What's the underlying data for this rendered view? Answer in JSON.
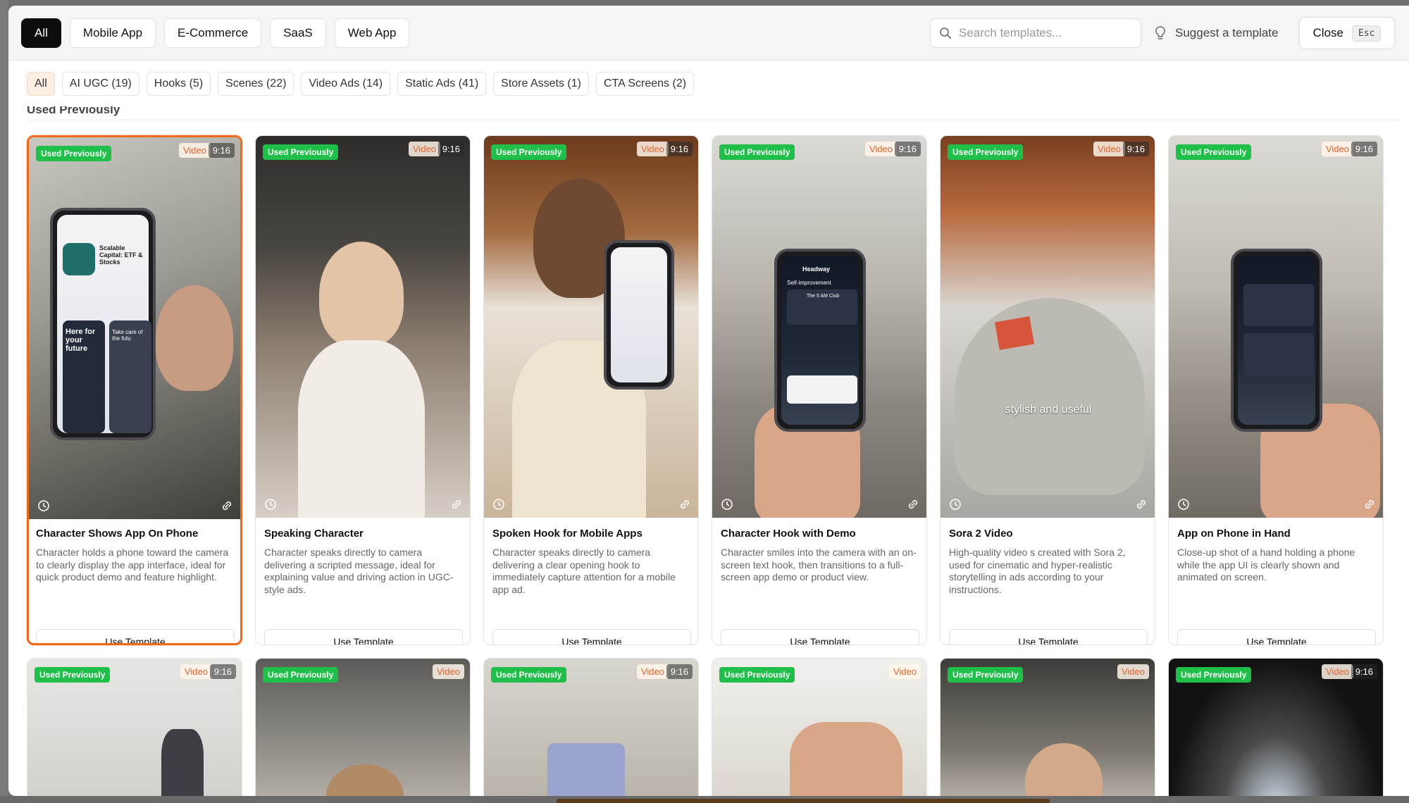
{
  "categories": [
    "All",
    "Mobile App",
    "E-Commerce",
    "SaaS",
    "Web App"
  ],
  "search": {
    "placeholder": "Search templates..."
  },
  "suggest_label": "Suggest a template",
  "close": {
    "label": "Close",
    "shortcut": "Esc"
  },
  "filters": [
    "All",
    "AI UGC (19)",
    "Hooks (5)",
    "Scenes (22)",
    "Video Ads (14)",
    "Static Ads (41)",
    "Store Assets (1)",
    "CTA Screens (2)"
  ],
  "section_title": "Used Previously",
  "badge_used": "Used Previously",
  "use_button_label": "Use Template",
  "templates": [
    {
      "type": "Video",
      "ratio": "9:16",
      "title": "Character Shows App On Phone",
      "description": "Character holds a phone toward the camera to clearly display the app interface, ideal for quick product demo and feature highlight."
    },
    {
      "type": "Video",
      "ratio": "9:16",
      "title": "Speaking Character",
      "description": "Character speaks directly to camera delivering a scripted message, ideal for explaining value and driving action in UGC-style ads."
    },
    {
      "type": "Video",
      "ratio": "9:16",
      "title": "Spoken Hook for Mobile Apps",
      "description": "Character speaks directly to camera delivering a clear opening hook to immediately capture attention for a mobile app ad."
    },
    {
      "type": "Video",
      "ratio": "9:16",
      "title": "Character Hook with Demo",
      "description": "Character smiles into the camera with an on-screen text hook, then transitions to a full-screen app demo or product view."
    },
    {
      "type": "Video",
      "ratio": "9:16",
      "title": "Sora 2 Video",
      "description": "High-quality video s created with Sora 2, used for cinematic and hyper-realistic storytelling in ads according to your instructions.",
      "overlay_text": "stylish and useful"
    },
    {
      "type": "Video",
      "ratio": "9:16",
      "title": "App on Phone in Hand",
      "description": "Close-up shot of a hand holding a phone while the app UI is clearly shown and animated on screen."
    }
  ],
  "templates_row2": [
    {
      "type": "Video",
      "ratio": "9:16"
    },
    {
      "type": "Video",
      "ratio": ""
    },
    {
      "type": "Video",
      "ratio": "9:16"
    },
    {
      "type": "Video",
      "ratio": ""
    },
    {
      "type": "Video",
      "ratio": ""
    },
    {
      "type": "Video",
      "ratio": "9:16"
    }
  ],
  "phone_screen_text": {
    "app_store_title": "Scalable Capital: ETF & Stocks",
    "promo_line": "Here for your future",
    "promo_line2": "Take care of the futu",
    "headway_title": "Headway",
    "headway_section": "Self-improvement",
    "headway_club": "The 5 AM Club"
  },
  "colors": {
    "accent": "#ef6a21",
    "used_badge": "#1fbf4a",
    "dark_tab": "#0d0d0d"
  }
}
